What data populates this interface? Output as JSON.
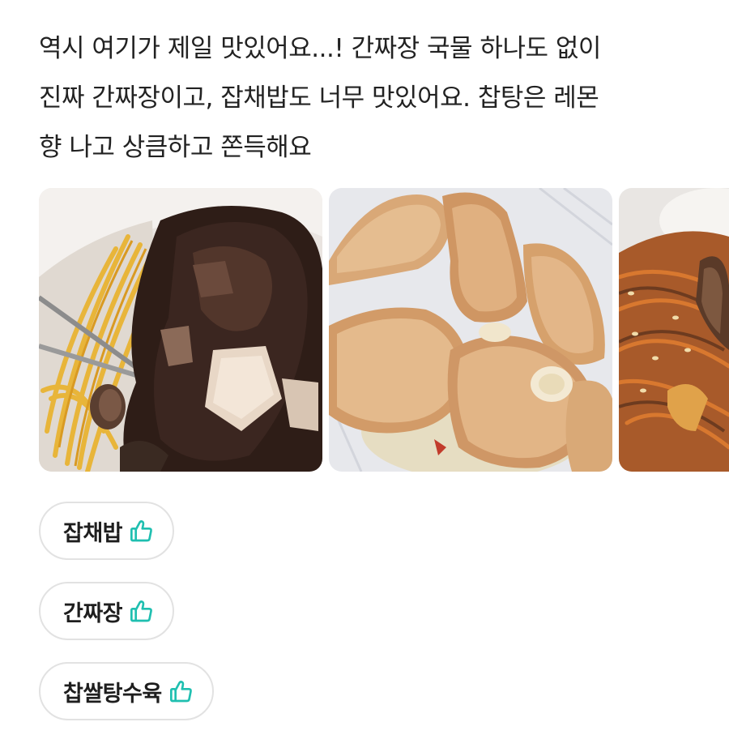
{
  "review": {
    "lines": [
      "역시 여기가 제일 맛있어요...! 간짜장 국물 하나도 없이",
      "진짜 간짜장이고, 잡채밥도 너무 맛있어요. 찹탕은 레몬",
      "향 나고 상큼하고 쫀득해요"
    ]
  },
  "photos": [
    {
      "name": "jjajang-photo"
    },
    {
      "name": "tangsuyuk-photo"
    },
    {
      "name": "japchae-photo"
    }
  ],
  "tags": [
    {
      "label": "잡채밥",
      "icon": "thumbs-up-icon"
    },
    {
      "label": "간짜장",
      "icon": "thumbs-up-icon"
    },
    {
      "label": "찹쌀탕수육",
      "icon": "thumbs-up-icon"
    }
  ],
  "colors": {
    "thumb_icon": "#1fbfb0",
    "tag_border": "#e2e2e2",
    "text": "#222222"
  }
}
